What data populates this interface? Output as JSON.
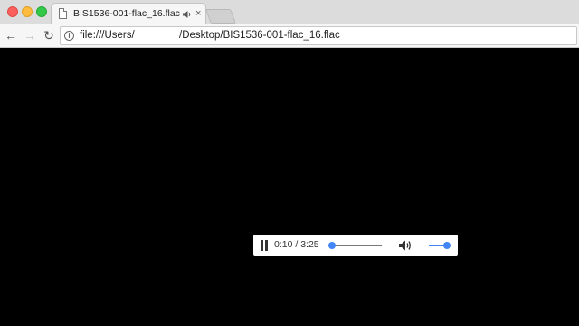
{
  "tab": {
    "title": "BIS1536-001-flac_16.flac",
    "close_glyph": "×"
  },
  "toolbar": {
    "back_glyph": "←",
    "forward_glyph": "→",
    "reload_glyph": "↻",
    "info_glyph": "i"
  },
  "address": {
    "url_part1": "file:///Users/",
    "url_part2": "/Desktop/BIS1536-001-flac_16.flac"
  },
  "player": {
    "time": "0:10 / 3:25",
    "progress_fraction": 0.05,
    "volume_fraction": 1.0
  },
  "icons": {
    "tab": "document-icon",
    "audio": "speaker-icon",
    "close": "close-icon",
    "info": "info-icon",
    "pause": "pause-icon",
    "volume": "volume-icon"
  },
  "colors": {
    "accent": "#4285f4",
    "viewport": "#000000",
    "chrome": "#dcdcdc",
    "toolbar": "#f6f6f6"
  }
}
